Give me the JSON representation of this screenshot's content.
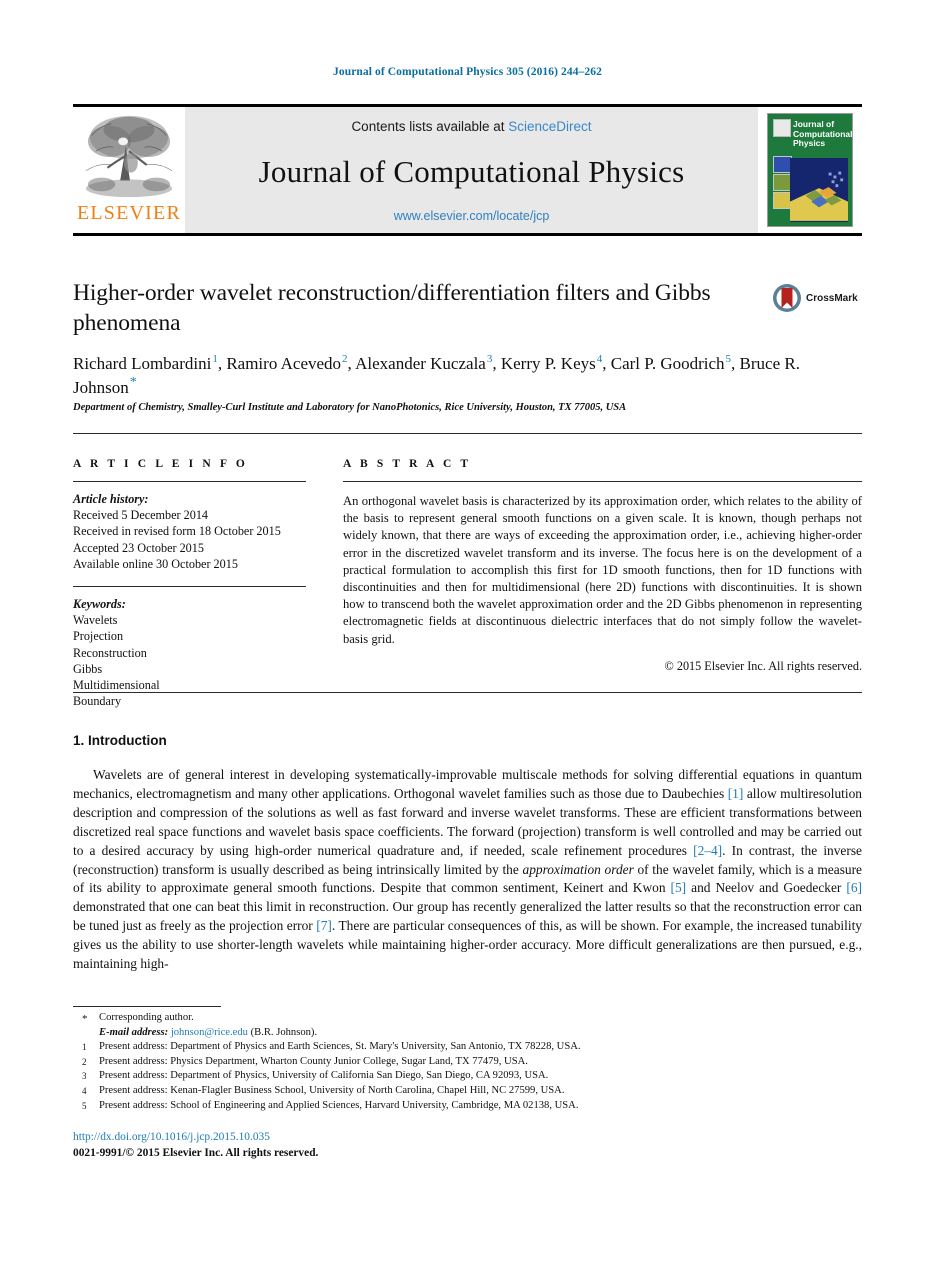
{
  "running_head": "Journal of Computational Physics 305 (2016) 244–262",
  "masthead": {
    "elsevier_wordmark": "ELSEVIER",
    "contents_prefix": "Contents lists available at ",
    "sciencedirect_link": "ScienceDirect",
    "journal_name": "Journal of Computational Physics",
    "journal_url": "www.elsevier.com/locate/jcp",
    "cover_title": "Journal of Computational Physics"
  },
  "article": {
    "title": "Higher-order wavelet reconstruction/differentiation filters and Gibbs phenomena",
    "crossmark_label": "CrossMark",
    "authors": [
      {
        "name": "Richard Lombardini",
        "mark": "1",
        "sep": ", "
      },
      {
        "name": "Ramiro Acevedo",
        "mark": "2",
        "sep": ", "
      },
      {
        "name": "Alexander Kuczala",
        "mark": "3",
        "sep": ", "
      },
      {
        "name": "Kerry P. Keys",
        "mark": "4",
        "sep": ", "
      },
      {
        "name": "Carl P. Goodrich",
        "mark": "5",
        "sep": ", "
      },
      {
        "name": "Bruce R. Johnson",
        "mark": "*",
        "sep": ""
      }
    ],
    "affiliation": "Department of Chemistry, Smalley-Curl Institute and Laboratory for NanoPhotonics, Rice University, Houston, TX 77005, USA"
  },
  "info": {
    "heading": "A R T I C L E   I N F O",
    "history_label": "Article history:",
    "history": [
      "Received 5 December 2014",
      "Received in revised form 18 October 2015",
      "Accepted 23 October 2015",
      "Available online 30 October 2015"
    ],
    "keywords_label": "Keywords:",
    "keywords": [
      "Wavelets",
      "Projection",
      "Reconstruction",
      "Gibbs",
      "Multidimensional",
      "Boundary"
    ]
  },
  "abstract": {
    "heading": "A B S T R A C T",
    "text": "An orthogonal wavelet basis is characterized by its approximation order, which relates to the ability of the basis to represent general smooth functions on a given scale. It is known, though perhaps not widely known, that there are ways of exceeding the approximation order, i.e., achieving higher-order error in the discretized wavelet transform and its inverse. The focus here is on the development of a practical formulation to accomplish this first for 1D smooth functions, then for 1D functions with discontinuities and then for multidimensional (here 2D) functions with discontinuities. It is shown how to transcend both the wavelet approximation order and the 2D Gibbs phenomenon in representing electromagnetic fields at discontinuous dielectric interfaces that do not simply follow the wavelet-basis grid.",
    "rights": "© 2015 Elsevier Inc. All rights reserved."
  },
  "body": {
    "section_heading": "1. Introduction",
    "paragraph": {
      "p1": "Wavelets are of general interest in developing systematically-improvable multiscale methods for solving differential equations in quantum mechanics, electromagnetism and many other applications. Orthogonal wavelet families such as those due to Daubechies ",
      "ref1": "[1]",
      "p2": " allow multiresolution description and compression of the solutions as well as fast forward and inverse wavelet transforms. These are efficient transformations between discretized real space functions and wavelet basis space coefficients. The forward (projection) transform is well controlled and may be carried out to a desired accuracy by using high-order numerical quadrature and, if needed, scale refinement procedures ",
      "ref2": "[2–4]",
      "p3": ". In contrast, the inverse (reconstruction) transform is usually described as being intrinsically limited by the ",
      "italic1": "approximation order",
      "p4": " of the wavelet family, which is a measure of its ability to approximate general smooth functions. Despite that common sentiment, Keinert and Kwon ",
      "ref3": "[5]",
      "p5": " and Neelov and Goedecker ",
      "ref4": "[6]",
      "p6": " demonstrated that one can beat this limit in reconstruction. Our group has recently generalized the latter results so that the reconstruction error can be tuned just as freely as the projection error ",
      "ref5": "[7]",
      "p7": ". There are particular consequences of this, as will be shown. For example, the increased tunability gives us the ability to use shorter-length wavelets while maintaining higher-order accuracy. More difficult generalizations are then pursued, e.g., maintaining high-"
    }
  },
  "footnotes": {
    "corresponding": {
      "mark": "*",
      "text": "Corresponding author."
    },
    "email_label": "E-mail address:",
    "email": "johnson@rice.edu",
    "email_suffix": " (B.R. Johnson).",
    "items": [
      {
        "mark": "1",
        "text": "Present address: Department of Physics and Earth Sciences, St. Mary's University, San Antonio, TX 78228, USA."
      },
      {
        "mark": "2",
        "text": "Present address: Physics Department, Wharton County Junior College, Sugar Land, TX 77479, USA."
      },
      {
        "mark": "3",
        "text": "Present address: Department of Physics, University of California San Diego, San Diego, CA 92093, USA."
      },
      {
        "mark": "4",
        "text": "Present address: Kenan-Flagler Business School, University of North Carolina, Chapel Hill, NC 27599, USA."
      },
      {
        "mark": "5",
        "text": "Present address: School of Engineering and Applied Sciences, Harvard University, Cambridge, MA 02138, USA."
      }
    ]
  },
  "footer": {
    "doi": "http://dx.doi.org/10.1016/j.jcp.2015.10.035",
    "issn_line": "0021-9991/© 2015 Elsevier Inc. All rights reserved."
  },
  "colors": {
    "link_blue": "#1f7bb6",
    "header_blue": "#0b6e9e",
    "elsevier_orange": "#f07f13",
    "cover_green": "#1d7a3c"
  }
}
